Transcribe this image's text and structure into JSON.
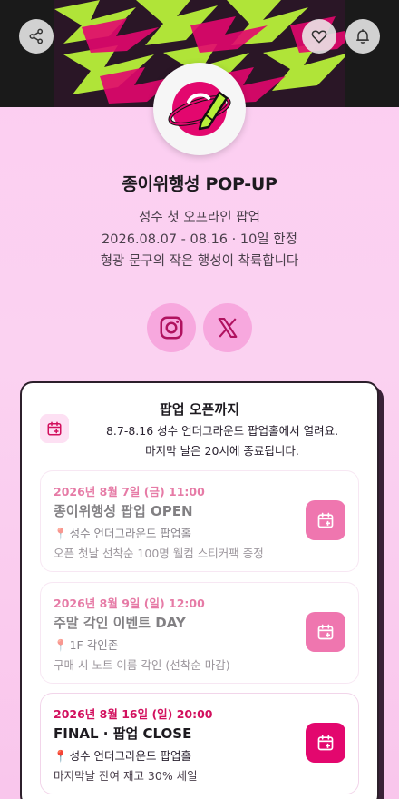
{
  "profile": {
    "title": "종이위행성 POP-UP",
    "desc_line1": "성수 첫 오프라인 팝업",
    "desc_line2": "2026.08.07 - 08.16 · 10일 한정",
    "desc_line3": "형광 문구의 작은 행성이 착륙합니다"
  },
  "header_icons": [
    "share-icon",
    "heart-icon",
    "bell-icon"
  ],
  "social": [
    "instagram-icon",
    "x-icon"
  ],
  "card": {
    "title": "팝업 오픈까지",
    "sub_line1": "8.7-8.16 성수 언더그라운드 팝업홀에서 열려요.",
    "sub_line2": "마지막 날은 20시에 종료됩니다."
  },
  "events": [
    {
      "date": "2026년 8월 7일 (금) 11:00",
      "name": "종이위행성 팝업 OPEN",
      "location": "성수 언더그라운드 팝업홀",
      "note": "오픈 첫날 선착순 100명 웰컴 스티커팩 증정",
      "past": true
    },
    {
      "date": "2026년 8월 9일 (일) 12:00",
      "name": "주말 각인 이벤트 DAY",
      "location": "1F 각인존",
      "note": "구매 시 노트 이름 각인 (선착순 마감)",
      "past": true
    },
    {
      "date": "2026년 8월 16일 (일) 20:00",
      "name": "FINAL · 팝업 CLOSE",
      "location": "성수 언더그라운드 팝업홀",
      "note": "마지막날 잔여 재고 30% 세일",
      "past": false
    }
  ],
  "colors": {
    "accent": "#e3076e",
    "background": "#fccdf1",
    "neon_green": "#b8f03a",
    "hot_pink": "#e3076e"
  }
}
